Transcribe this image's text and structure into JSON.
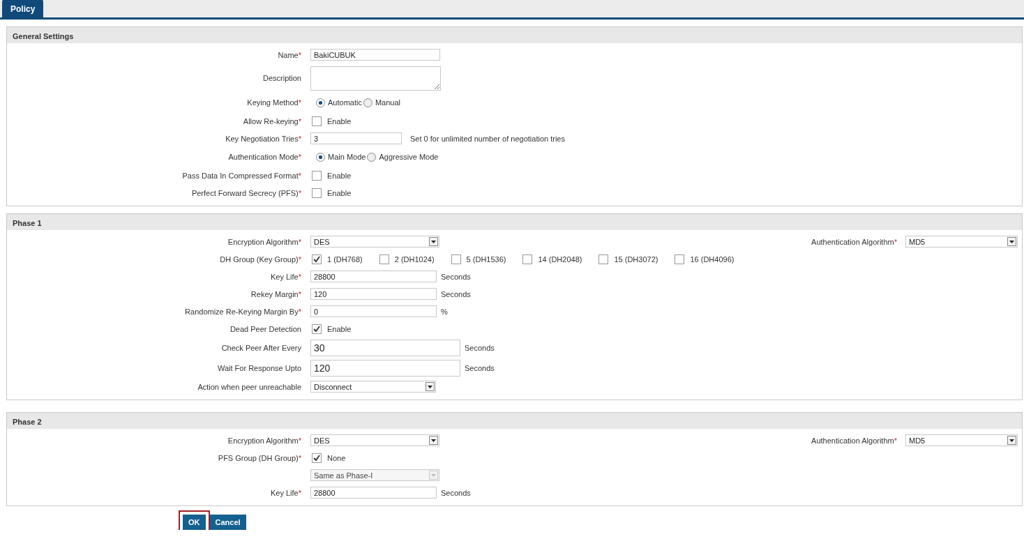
{
  "tabs": [
    {
      "label": "Policy",
      "selected": true
    }
  ],
  "sections": [
    {
      "title": "General Settings",
      "rows": [
        {
          "kind": "text",
          "label": "Name",
          "mark": "*",
          "value": "BakiCUBUK"
        },
        {
          "kind": "textarea",
          "label": "Description"
        },
        {
          "kind": "radio",
          "label": "Keying Method",
          "mark": "*",
          "options": [
            {
              "label": "Automatic",
              "selected": true
            },
            {
              "label": "Manual",
              "selected": false
            }
          ]
        },
        {
          "kind": "checkbox",
          "label": "Allow Re-keying",
          "mark": "*",
          "option": "Enable",
          "checked": false
        },
        {
          "kind": "text",
          "label": "Key Negotiation Tries",
          "mark": "*",
          "value": "3",
          "hint": "Set 0 for unlimited number of negotiation tries"
        },
        {
          "kind": "radio",
          "label": "Authentication Mode",
          "mark": "*",
          "options": [
            {
              "label": "Main Mode",
              "selected": true
            },
            {
              "label": "Aggressive Mode",
              "selected": false
            }
          ]
        },
        {
          "kind": "checkbox",
          "label": "Pass Data In Compressed Format",
          "mark": "*",
          "option": "Enable",
          "checked": false
        },
        {
          "kind": "checkbox",
          "label": "Perfect Forward Secrecy (PFS)",
          "mark": "*",
          "option": "Enable",
          "checked": false
        }
      ]
    },
    {
      "title": "Phase 1",
      "rows": [
        {
          "kind": "select",
          "label": "Encryption Algorithm",
          "mark": "*",
          "value": "DES",
          "disabled": false,
          "aside": {
            "label": "Authentication Algorithm",
            "mark": "*",
            "value": "MD5"
          }
        },
        {
          "kind": "checkgroup",
          "label": "DH Group (Key Group)",
          "mark": "*",
          "options": [
            {
              "label": "1 (DH768)",
              "checked": true
            },
            {
              "label": "2 (DH1024)",
              "checked": false
            },
            {
              "label": "5 (DH1536)",
              "checked": false
            },
            {
              "label": "14 (DH2048)",
              "checked": false
            },
            {
              "label": "15 (DH3072)",
              "checked": false
            },
            {
              "label": "16 (DH4096)",
              "checked": false
            }
          ]
        },
        {
          "kind": "text",
          "label": "Key Life",
          "mark": "*",
          "value": "28800",
          "suffix": "Seconds"
        },
        {
          "kind": "text",
          "label": "Rekey Margin",
          "mark": "*",
          "value": "120",
          "suffix": "Seconds"
        },
        {
          "kind": "text",
          "label": "Randomize Re-Keying Margin By",
          "mark": "*",
          "value": "0",
          "suffix": "%"
        },
        {
          "kind": "checkbox",
          "label": "Dead Peer Detection",
          "option": "Enable",
          "checked": true
        },
        {
          "kind": "text-large",
          "label": "Check Peer After Every",
          "value": "30",
          "suffix": "Seconds"
        },
        {
          "kind": "text-large",
          "label": "Wait For Response Upto",
          "value": "120",
          "suffix": "Seconds"
        },
        {
          "kind": "select",
          "label": "Action when peer unreachable",
          "value": "Disconnect",
          "disabled": false
        }
      ]
    },
    {
      "title": "Phase 2",
      "rows": [
        {
          "kind": "select",
          "label": "Encryption Algorithm",
          "mark": "*",
          "value": "DES",
          "disabled": false,
          "aside": {
            "label": "Authentication Algorithm",
            "mark": "*",
            "value": "MD5"
          }
        },
        {
          "kind": "checkbox",
          "label": "PFS Group (DH Group)",
          "mark": "*",
          "option": "None",
          "checked": true
        },
        {
          "kind": "select",
          "value": "Same as Phase-I",
          "disabled": true
        },
        {
          "kind": "text",
          "label": "Key Life",
          "mark": "*",
          "value": "28800",
          "suffix": "Seconds"
        }
      ]
    }
  ],
  "buttons": [
    {
      "label": "OK",
      "highlighted": true
    },
    {
      "label": "Cancel",
      "highlighted": false
    }
  ]
}
